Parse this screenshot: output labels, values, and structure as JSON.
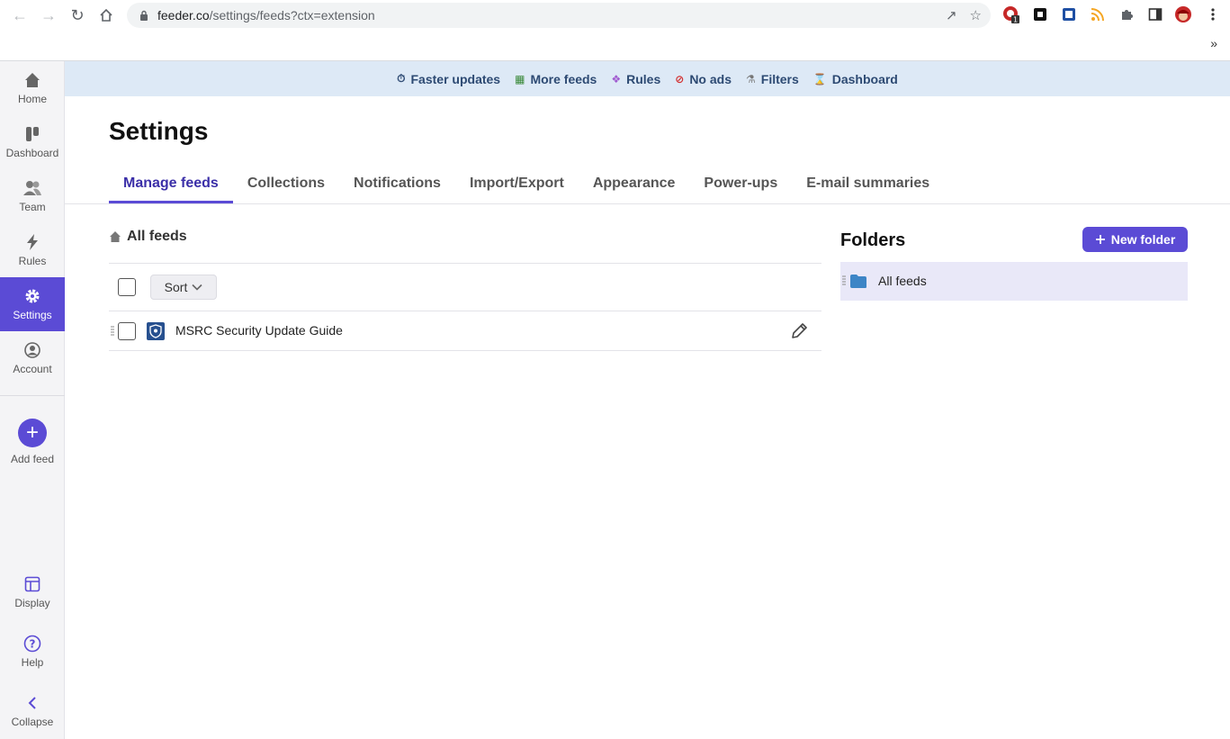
{
  "browser": {
    "url_host": "feeder.co",
    "url_path": "/settings/feeds?ctx=extension",
    "extension_badge": "1",
    "overflow": "»"
  },
  "promo": {
    "items": [
      {
        "label": "Faster updates",
        "icon": "stopwatch-icon"
      },
      {
        "label": "More feeds",
        "icon": "books-icon"
      },
      {
        "label": "Rules",
        "icon": "unicorn-icon"
      },
      {
        "label": "No ads",
        "icon": "no-entry-icon"
      },
      {
        "label": "Filters",
        "icon": "microscope-icon"
      },
      {
        "label": "Dashboard",
        "icon": "hourglass-icon"
      }
    ]
  },
  "sidebar": {
    "home": "Home",
    "dashboard": "Dashboard",
    "team": "Team",
    "rules": "Rules",
    "settings": "Settings",
    "account": "Account",
    "add_feed": "Add feed",
    "display": "Display",
    "help": "Help",
    "collapse": "Collapse"
  },
  "page": {
    "title": "Settings",
    "tabs": [
      "Manage feeds",
      "Collections",
      "Notifications",
      "Import/Export",
      "Appearance",
      "Power-ups",
      "E-mail summaries"
    ],
    "active_tab": "Manage feeds"
  },
  "feeds": {
    "heading": "All feeds",
    "sort_label": "Sort",
    "items": [
      {
        "name": "MSRC Security Update Guide"
      }
    ]
  },
  "folders": {
    "title": "Folders",
    "new_folder_label": "New folder",
    "items": [
      {
        "name": "All feeds"
      }
    ]
  },
  "colors": {
    "accent": "#5b4bd5",
    "promo_bg": "#dde9f6",
    "folder_selected_bg": "#e9e8f8"
  }
}
